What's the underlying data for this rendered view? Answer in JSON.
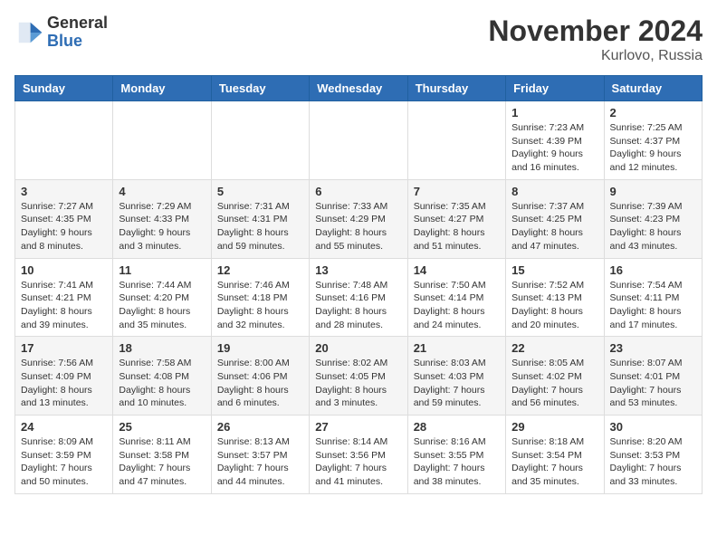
{
  "header": {
    "logo_line1": "General",
    "logo_line2": "Blue",
    "month": "November 2024",
    "location": "Kurlovo, Russia"
  },
  "weekdays": [
    "Sunday",
    "Monday",
    "Tuesday",
    "Wednesday",
    "Thursday",
    "Friday",
    "Saturday"
  ],
  "weeks": [
    [
      {
        "day": "",
        "info": ""
      },
      {
        "day": "",
        "info": ""
      },
      {
        "day": "",
        "info": ""
      },
      {
        "day": "",
        "info": ""
      },
      {
        "day": "",
        "info": ""
      },
      {
        "day": "1",
        "info": "Sunrise: 7:23 AM\nSunset: 4:39 PM\nDaylight: 9 hours and 16 minutes."
      },
      {
        "day": "2",
        "info": "Sunrise: 7:25 AM\nSunset: 4:37 PM\nDaylight: 9 hours and 12 minutes."
      }
    ],
    [
      {
        "day": "3",
        "info": "Sunrise: 7:27 AM\nSunset: 4:35 PM\nDaylight: 9 hours and 8 minutes."
      },
      {
        "day": "4",
        "info": "Sunrise: 7:29 AM\nSunset: 4:33 PM\nDaylight: 9 hours and 3 minutes."
      },
      {
        "day": "5",
        "info": "Sunrise: 7:31 AM\nSunset: 4:31 PM\nDaylight: 8 hours and 59 minutes."
      },
      {
        "day": "6",
        "info": "Sunrise: 7:33 AM\nSunset: 4:29 PM\nDaylight: 8 hours and 55 minutes."
      },
      {
        "day": "7",
        "info": "Sunrise: 7:35 AM\nSunset: 4:27 PM\nDaylight: 8 hours and 51 minutes."
      },
      {
        "day": "8",
        "info": "Sunrise: 7:37 AM\nSunset: 4:25 PM\nDaylight: 8 hours and 47 minutes."
      },
      {
        "day": "9",
        "info": "Sunrise: 7:39 AM\nSunset: 4:23 PM\nDaylight: 8 hours and 43 minutes."
      }
    ],
    [
      {
        "day": "10",
        "info": "Sunrise: 7:41 AM\nSunset: 4:21 PM\nDaylight: 8 hours and 39 minutes."
      },
      {
        "day": "11",
        "info": "Sunrise: 7:44 AM\nSunset: 4:20 PM\nDaylight: 8 hours and 35 minutes."
      },
      {
        "day": "12",
        "info": "Sunrise: 7:46 AM\nSunset: 4:18 PM\nDaylight: 8 hours and 32 minutes."
      },
      {
        "day": "13",
        "info": "Sunrise: 7:48 AM\nSunset: 4:16 PM\nDaylight: 8 hours and 28 minutes."
      },
      {
        "day": "14",
        "info": "Sunrise: 7:50 AM\nSunset: 4:14 PM\nDaylight: 8 hours and 24 minutes."
      },
      {
        "day": "15",
        "info": "Sunrise: 7:52 AM\nSunset: 4:13 PM\nDaylight: 8 hours and 20 minutes."
      },
      {
        "day": "16",
        "info": "Sunrise: 7:54 AM\nSunset: 4:11 PM\nDaylight: 8 hours and 17 minutes."
      }
    ],
    [
      {
        "day": "17",
        "info": "Sunrise: 7:56 AM\nSunset: 4:09 PM\nDaylight: 8 hours and 13 minutes."
      },
      {
        "day": "18",
        "info": "Sunrise: 7:58 AM\nSunset: 4:08 PM\nDaylight: 8 hours and 10 minutes."
      },
      {
        "day": "19",
        "info": "Sunrise: 8:00 AM\nSunset: 4:06 PM\nDaylight: 8 hours and 6 minutes."
      },
      {
        "day": "20",
        "info": "Sunrise: 8:02 AM\nSunset: 4:05 PM\nDaylight: 8 hours and 3 minutes."
      },
      {
        "day": "21",
        "info": "Sunrise: 8:03 AM\nSunset: 4:03 PM\nDaylight: 7 hours and 59 minutes."
      },
      {
        "day": "22",
        "info": "Sunrise: 8:05 AM\nSunset: 4:02 PM\nDaylight: 7 hours and 56 minutes."
      },
      {
        "day": "23",
        "info": "Sunrise: 8:07 AM\nSunset: 4:01 PM\nDaylight: 7 hours and 53 minutes."
      }
    ],
    [
      {
        "day": "24",
        "info": "Sunrise: 8:09 AM\nSunset: 3:59 PM\nDaylight: 7 hours and 50 minutes."
      },
      {
        "day": "25",
        "info": "Sunrise: 8:11 AM\nSunset: 3:58 PM\nDaylight: 7 hours and 47 minutes."
      },
      {
        "day": "26",
        "info": "Sunrise: 8:13 AM\nSunset: 3:57 PM\nDaylight: 7 hours and 44 minutes."
      },
      {
        "day": "27",
        "info": "Sunrise: 8:14 AM\nSunset: 3:56 PM\nDaylight: 7 hours and 41 minutes."
      },
      {
        "day": "28",
        "info": "Sunrise: 8:16 AM\nSunset: 3:55 PM\nDaylight: 7 hours and 38 minutes."
      },
      {
        "day": "29",
        "info": "Sunrise: 8:18 AM\nSunset: 3:54 PM\nDaylight: 7 hours and 35 minutes."
      },
      {
        "day": "30",
        "info": "Sunrise: 8:20 AM\nSunset: 3:53 PM\nDaylight: 7 hours and 33 minutes."
      }
    ]
  ]
}
